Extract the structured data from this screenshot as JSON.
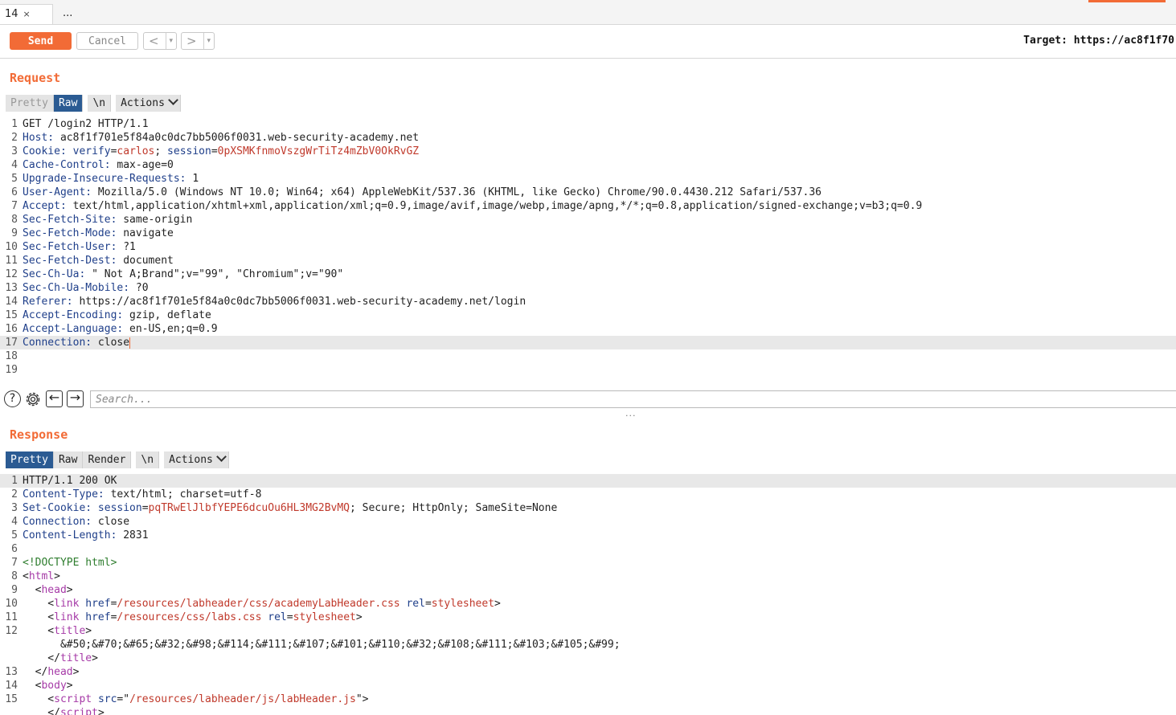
{
  "tabs": [
    {
      "label": "14",
      "close": "×"
    },
    {
      "label": "..."
    }
  ],
  "toolbar": {
    "send": "Send",
    "cancel": "Cancel",
    "back": "<",
    "forward": ">",
    "dropdown": "▾",
    "target": "Target: https://ac8f1f70"
  },
  "request": {
    "title": "Request",
    "tabs": {
      "pretty": "Pretty",
      "raw": "Raw",
      "newline": "\\n",
      "actions": "Actions"
    },
    "lines": [
      {
        "n": "1",
        "parts": [
          {
            "t": "GET /login2 HTTP/1.1",
            "c": ""
          }
        ]
      },
      {
        "n": "2",
        "parts": [
          {
            "t": "Host:",
            "c": "hn"
          },
          {
            "t": " ac8f1f701e5f84a0c0dc7bb5006f0031.web-security-academy.net",
            "c": ""
          }
        ]
      },
      {
        "n": "3",
        "parts": [
          {
            "t": "Cookie:",
            "c": "hn"
          },
          {
            "t": " ",
            "c": ""
          },
          {
            "t": "verify",
            "c": "ck"
          },
          {
            "t": "=",
            "c": ""
          },
          {
            "t": "carlos",
            "c": "cv"
          },
          {
            "t": "; ",
            "c": ""
          },
          {
            "t": "session",
            "c": "ck"
          },
          {
            "t": "=",
            "c": ""
          },
          {
            "t": "0pXSMKfnmoVszgWrTiTz4mZbV0OkRvGZ",
            "c": "cv"
          }
        ]
      },
      {
        "n": "4",
        "parts": [
          {
            "t": "Cache-Control:",
            "c": "hn"
          },
          {
            "t": " max-age=0",
            "c": ""
          }
        ]
      },
      {
        "n": "5",
        "parts": [
          {
            "t": "Upgrade-Insecure-Requests:",
            "c": "hn"
          },
          {
            "t": " 1",
            "c": ""
          }
        ]
      },
      {
        "n": "6",
        "parts": [
          {
            "t": "User-Agent:",
            "c": "hn"
          },
          {
            "t": " Mozilla/5.0 (Windows NT 10.0; Win64; x64) AppleWebKit/537.36 (KHTML, like Gecko) Chrome/90.0.4430.212 Safari/537.36",
            "c": ""
          }
        ]
      },
      {
        "n": "7",
        "parts": [
          {
            "t": "Accept:",
            "c": "hn"
          },
          {
            "t": " text/html,application/xhtml+xml,application/xml;q=0.9,image/avif,image/webp,image/apng,*/*;q=0.8,application/signed-exchange;v=b3;q=0.9",
            "c": ""
          }
        ]
      },
      {
        "n": "8",
        "parts": [
          {
            "t": "Sec-Fetch-Site:",
            "c": "hn"
          },
          {
            "t": " same-origin",
            "c": ""
          }
        ]
      },
      {
        "n": "9",
        "parts": [
          {
            "t": "Sec-Fetch-Mode:",
            "c": "hn"
          },
          {
            "t": " navigate",
            "c": ""
          }
        ]
      },
      {
        "n": "10",
        "parts": [
          {
            "t": "Sec-Fetch-User:",
            "c": "hn"
          },
          {
            "t": " ?1",
            "c": ""
          }
        ]
      },
      {
        "n": "11",
        "parts": [
          {
            "t": "Sec-Fetch-Dest:",
            "c": "hn"
          },
          {
            "t": " document",
            "c": ""
          }
        ]
      },
      {
        "n": "12",
        "parts": [
          {
            "t": "Sec-Ch-Ua:",
            "c": "hn"
          },
          {
            "t": " \" Not A;Brand\";v=\"99\", \"Chromium\";v=\"90\"",
            "c": ""
          }
        ]
      },
      {
        "n": "13",
        "parts": [
          {
            "t": "Sec-Ch-Ua-Mobile:",
            "c": "hn"
          },
          {
            "t": " ?0",
            "c": ""
          }
        ]
      },
      {
        "n": "14",
        "parts": [
          {
            "t": "Referer:",
            "c": "hn"
          },
          {
            "t": " https://ac8f1f701e5f84a0c0dc7bb5006f0031.web-security-academy.net/login",
            "c": ""
          }
        ]
      },
      {
        "n": "15",
        "parts": [
          {
            "t": "Accept-Encoding:",
            "c": "hn"
          },
          {
            "t": " gzip, deflate",
            "c": ""
          }
        ]
      },
      {
        "n": "16",
        "parts": [
          {
            "t": "Accept-Language:",
            "c": "hn"
          },
          {
            "t": " en-US,en;q=0.9",
            "c": ""
          }
        ]
      },
      {
        "n": "17",
        "hl": true,
        "caret": true,
        "parts": [
          {
            "t": "Connection:",
            "c": "hn"
          },
          {
            "t": " close",
            "c": ""
          }
        ]
      },
      {
        "n": "18",
        "parts": []
      },
      {
        "n": "19",
        "parts": []
      }
    ]
  },
  "search": {
    "placeholder": "Search...",
    "help": "?",
    "prev": "←",
    "next": "→",
    "handle": "···"
  },
  "response": {
    "title": "Response",
    "tabs": {
      "pretty": "Pretty",
      "raw": "Raw",
      "render": "Render",
      "newline": "\\n",
      "actions": "Actions"
    },
    "lines": [
      {
        "n": "1",
        "hl": true,
        "parts": [
          {
            "t": "HTTP/1.1 200 OK",
            "c": ""
          }
        ]
      },
      {
        "n": "2",
        "parts": [
          {
            "t": "Content-Type:",
            "c": "hn"
          },
          {
            "t": " text/html; charset=utf-8",
            "c": ""
          }
        ]
      },
      {
        "n": "3",
        "parts": [
          {
            "t": "Set-Cookie:",
            "c": "hn"
          },
          {
            "t": " ",
            "c": ""
          },
          {
            "t": "session",
            "c": "ck"
          },
          {
            "t": "=",
            "c": ""
          },
          {
            "t": "pqTRwElJlbfYEPE6dcuOu6HL3MG2BvMQ",
            "c": "cv"
          },
          {
            "t": "; Secure; HttpOnly; SameSite=None",
            "c": ""
          }
        ]
      },
      {
        "n": "4",
        "parts": [
          {
            "t": "Connection:",
            "c": "hn"
          },
          {
            "t": " close",
            "c": ""
          }
        ]
      },
      {
        "n": "5",
        "parts": [
          {
            "t": "Content-Length:",
            "c": "hn"
          },
          {
            "t": " 2831",
            "c": ""
          }
        ]
      },
      {
        "n": "6",
        "parts": []
      },
      {
        "n": "7",
        "parts": [
          {
            "t": "<!DOCTYPE html>",
            "c": "dt"
          }
        ]
      },
      {
        "n": "8",
        "parts": [
          {
            "t": "<",
            "c": ""
          },
          {
            "t": "html",
            "c": "tag"
          },
          {
            "t": ">",
            "c": ""
          }
        ]
      },
      {
        "n": "9",
        "parts": [
          {
            "t": "  <",
            "c": ""
          },
          {
            "t": "head",
            "c": "tag"
          },
          {
            "t": ">",
            "c": ""
          }
        ]
      },
      {
        "n": "10",
        "parts": [
          {
            "t": "    <",
            "c": ""
          },
          {
            "t": "link",
            "c": "tag"
          },
          {
            "t": " ",
            "c": ""
          },
          {
            "t": "href",
            "c": "at"
          },
          {
            "t": "=",
            "c": ""
          },
          {
            "t": "/resources/labheader/css/academyLabHeader.css",
            "c": "av"
          },
          {
            "t": " ",
            "c": ""
          },
          {
            "t": "rel",
            "c": "at"
          },
          {
            "t": "=",
            "c": ""
          },
          {
            "t": "stylesheet",
            "c": "av"
          },
          {
            "t": ">",
            "c": ""
          }
        ]
      },
      {
        "n": "11",
        "parts": [
          {
            "t": "    <",
            "c": ""
          },
          {
            "t": "link",
            "c": "tag"
          },
          {
            "t": " ",
            "c": ""
          },
          {
            "t": "href",
            "c": "at"
          },
          {
            "t": "=",
            "c": ""
          },
          {
            "t": "/resources/css/labs.css",
            "c": "av"
          },
          {
            "t": " ",
            "c": ""
          },
          {
            "t": "rel",
            "c": "at"
          },
          {
            "t": "=",
            "c": ""
          },
          {
            "t": "stylesheet",
            "c": "av"
          },
          {
            "t": ">",
            "c": ""
          }
        ]
      },
      {
        "n": "12",
        "parts": [
          {
            "t": "    <",
            "c": ""
          },
          {
            "t": "title",
            "c": "tag"
          },
          {
            "t": ">",
            "c": ""
          }
        ]
      },
      {
        "n": "",
        "parts": [
          {
            "t": "      &#50;&#70;&#65;&#32;&#98;&#114;&#111;&#107;&#101;&#110;&#32;&#108;&#111;&#103;&#105;&#99;",
            "c": ""
          }
        ]
      },
      {
        "n": "",
        "parts": [
          {
            "t": "    </",
            "c": ""
          },
          {
            "t": "title",
            "c": "tag"
          },
          {
            "t": ">",
            "c": ""
          }
        ]
      },
      {
        "n": "13",
        "parts": [
          {
            "t": "  </",
            "c": ""
          },
          {
            "t": "head",
            "c": "tag"
          },
          {
            "t": ">",
            "c": ""
          }
        ]
      },
      {
        "n": "14",
        "parts": [
          {
            "t": "  <",
            "c": ""
          },
          {
            "t": "body",
            "c": "tag"
          },
          {
            "t": ">",
            "c": ""
          }
        ]
      },
      {
        "n": "15",
        "parts": [
          {
            "t": "    <",
            "c": ""
          },
          {
            "t": "script",
            "c": "tag"
          },
          {
            "t": " ",
            "c": ""
          },
          {
            "t": "src",
            "c": "at"
          },
          {
            "t": "=\"",
            "c": ""
          },
          {
            "t": "/resources/labheader/js/labHeader.js",
            "c": "av"
          },
          {
            "t": "\">",
            "c": ""
          }
        ]
      },
      {
        "n": "",
        "parts": [
          {
            "t": "    </",
            "c": ""
          },
          {
            "t": "script",
            "c": "tag"
          },
          {
            "t": ">",
            "c": ""
          }
        ]
      }
    ]
  }
}
